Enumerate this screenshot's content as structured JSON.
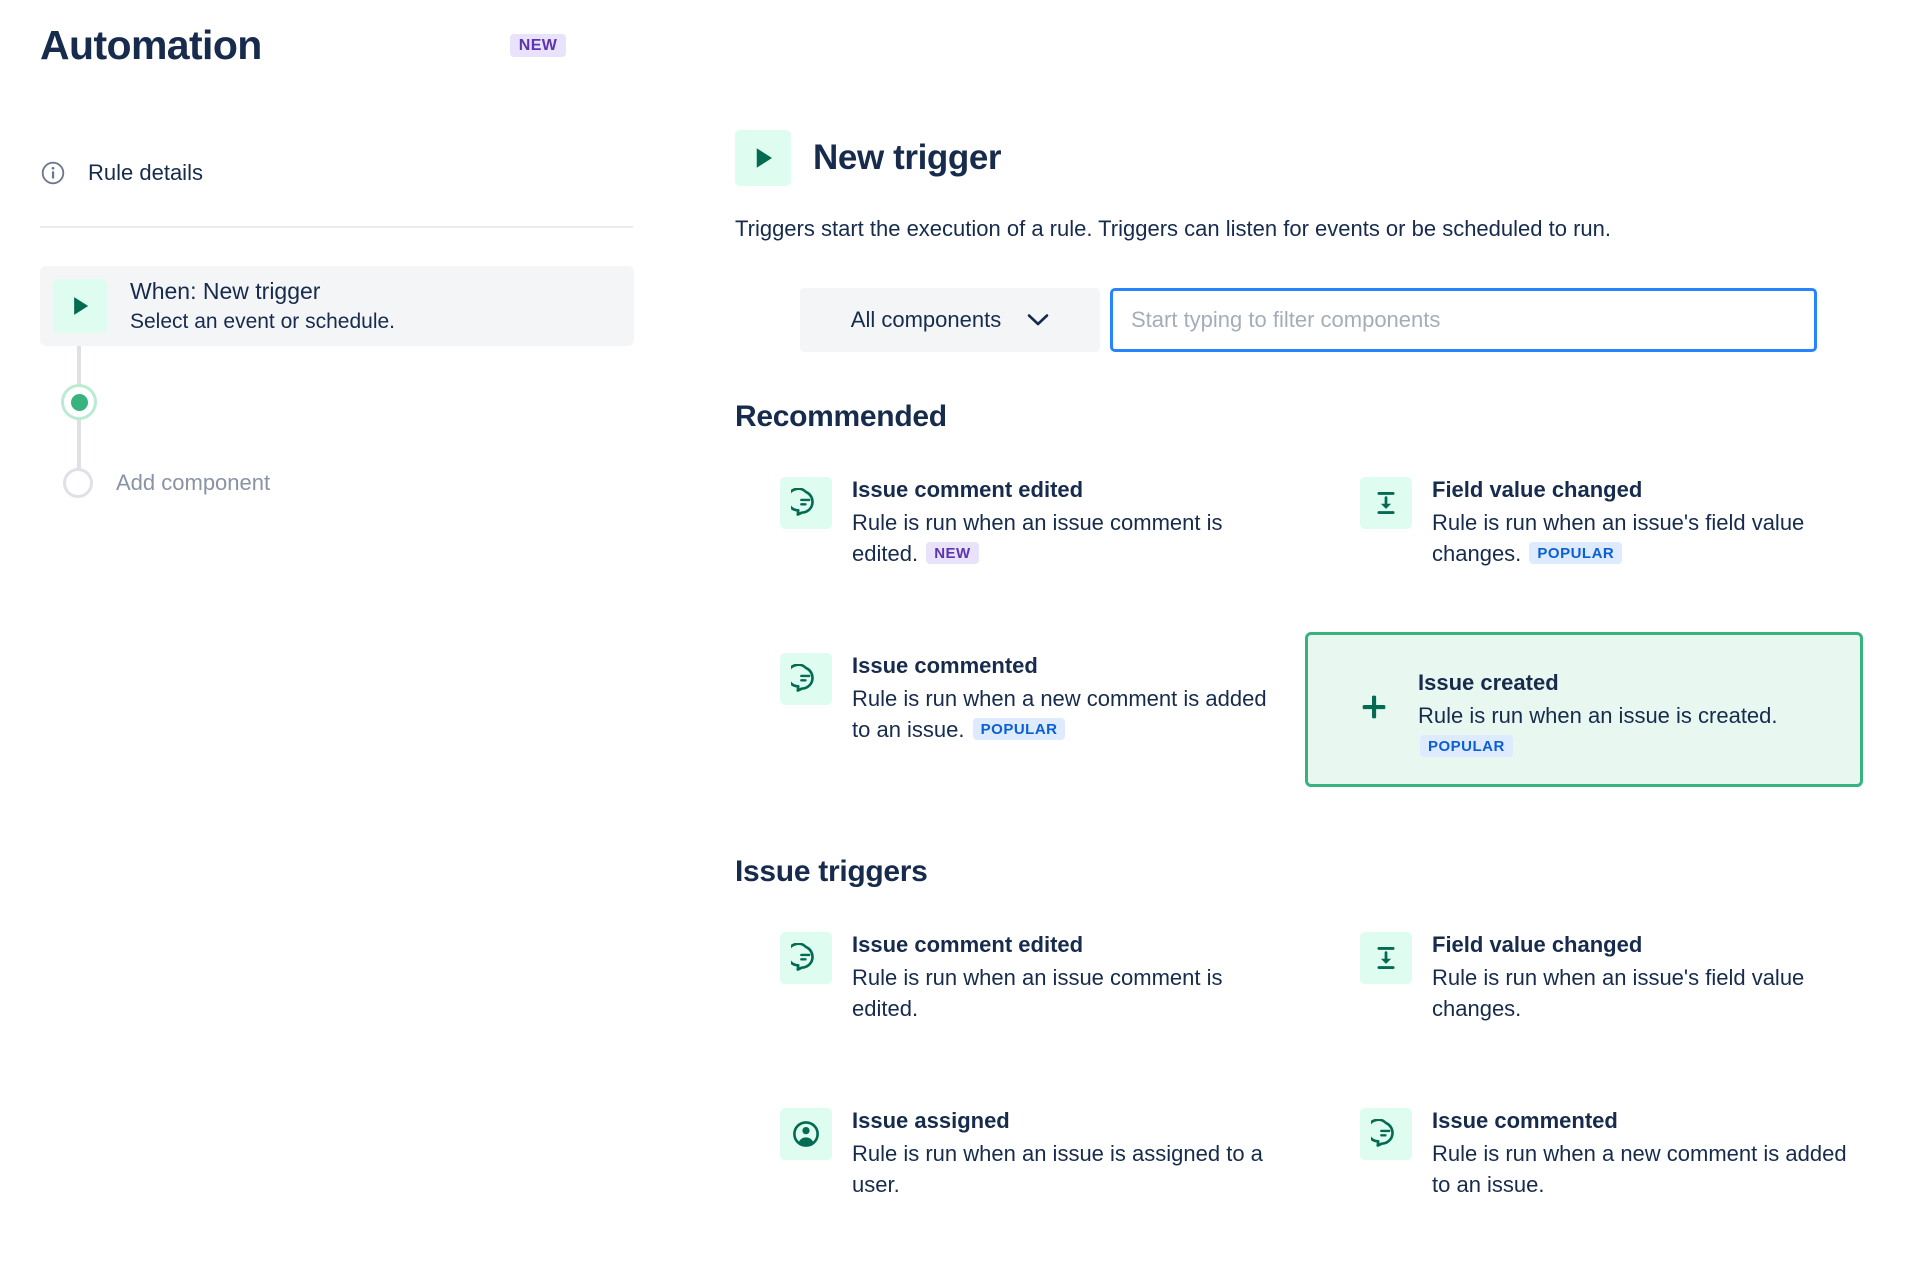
{
  "app": {
    "title": "Automation",
    "header_badge": "NEW"
  },
  "sidebar": {
    "rule_details": {
      "label": "Rule details",
      "icon": "info-icon"
    },
    "timeline": {
      "when_step": {
        "icon": "play-icon",
        "title": "When: New trigger",
        "subtitle": "Select an event or schedule."
      },
      "add_component_label": "Add component"
    }
  },
  "main": {
    "header": {
      "icon": "play-icon",
      "title": "New trigger",
      "description": "Triggers start the execution of a rule. Triggers can listen for events or be scheduled to run."
    },
    "filter": {
      "select_label": "All components",
      "select_icon": "chevron-down-icon",
      "input_placeholder": "Start typing to filter components",
      "input_value": ""
    },
    "sections": [
      {
        "title": "Recommended",
        "cards": [
          {
            "icon": "comment-icon",
            "title": "Issue comment edited",
            "description": "Rule is run when an issue comment is edited.",
            "badge": "NEW",
            "badge_type": "new",
            "selected": false
          },
          {
            "icon": "field-value-icon",
            "title": "Field value changed",
            "description": "Rule is run when an issue's field value changes.",
            "badge": "POPULAR",
            "badge_type": "popular",
            "selected": false
          },
          {
            "icon": "comment-icon",
            "title": "Issue commented",
            "description": "Rule is run when a new comment is added to an issue.",
            "badge": "POPULAR",
            "badge_type": "popular",
            "selected": false
          },
          {
            "icon": "plus-icon",
            "title": "Issue created",
            "description": "Rule is run when an issue is created.",
            "badge": "POPULAR",
            "badge_type": "popular",
            "selected": true
          }
        ]
      },
      {
        "title": "Issue triggers",
        "cards": [
          {
            "icon": "comment-icon",
            "title": "Issue comment edited",
            "description": "Rule is run when an issue comment is edited.",
            "badge": "",
            "badge_type": "",
            "selected": false
          },
          {
            "icon": "field-value-icon",
            "title": "Field value changed",
            "description": "Rule is run when an issue's field value changes.",
            "badge": "",
            "badge_type": "",
            "selected": false
          },
          {
            "icon": "person-icon",
            "title": "Issue assigned",
            "description": "Rule is run when an issue is assigned to a user.",
            "badge": "",
            "badge_type": "",
            "selected": false
          },
          {
            "icon": "comment-icon",
            "title": "Issue commented",
            "description": "Rule is run when a new comment is added to an issue.",
            "badge": "",
            "badge_type": "",
            "selected": false
          }
        ]
      }
    ]
  },
  "colors": {
    "green_accent": "#36B37E",
    "green_icon": "#036B52",
    "icon_bg": "#DFFCF0",
    "selected_bg": "#E8F8F1",
    "focus_blue": "#2684FF",
    "text": "#172B4D",
    "badge_new_bg": "#E9E2FB",
    "badge_new_fg": "#5E35B1",
    "badge_popular_bg": "#DEEBFF",
    "badge_popular_fg": "#0B5FD0"
  }
}
